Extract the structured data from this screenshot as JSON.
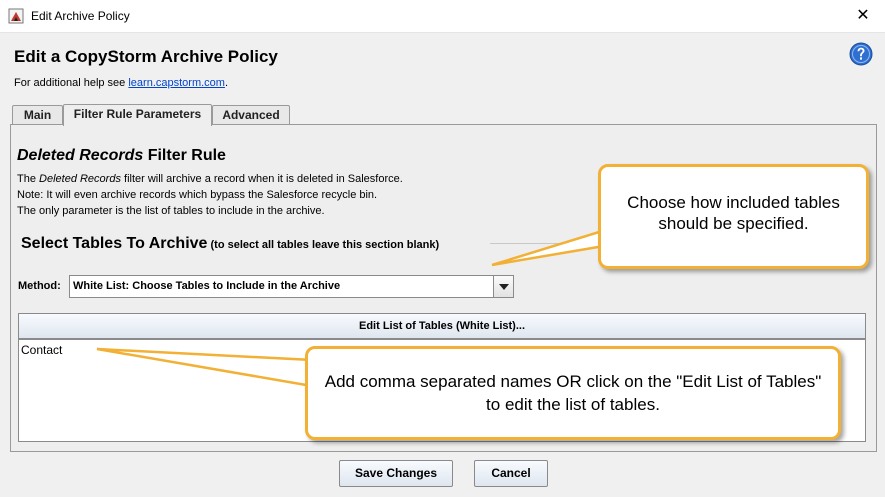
{
  "window": {
    "title": "Edit Archive Policy",
    "close_glyph": "✕"
  },
  "header": {
    "title": "Edit a CopyStorm Archive Policy",
    "help_prefix": "For additional help see ",
    "help_link": "learn.capstorm.com",
    "help_suffix": ".",
    "help_icon": "help-question-icon"
  },
  "tabs": [
    {
      "label": "Main",
      "active": false
    },
    {
      "label": "Filter Rule Parameters",
      "active": true
    },
    {
      "label": "Advanced",
      "active": false
    }
  ],
  "rule": {
    "title_italic": "Deleted Records",
    "title_rest": " Filter Rule",
    "line1_prefix": "The ",
    "line1_italic": "Deleted Records",
    "line1_rest": " filter will archive a record when it is deleted in Salesforce.",
    "line2": "Note: It will even archive records which bypass the Salesforce recycle bin.",
    "line3": "The only parameter is the list of tables to include in the archive."
  },
  "section": {
    "title": "Select Tables To Archive",
    "note": " (to select all tables leave this section blank)"
  },
  "method": {
    "label": "Method:",
    "value": "White List: Choose Tables to Include in the Archive"
  },
  "edit_list_button": "Edit List of Tables (White List)...",
  "tables_text": "Contact",
  "buttons": {
    "save": "Save Changes",
    "cancel": "Cancel"
  },
  "callouts": {
    "top": "Choose how included tables should be specified.",
    "bottom": "Add comma separated names OR click on the \"Edit List of Tables\" to edit the list of tables."
  },
  "colors": {
    "callout_border": "#f2b035",
    "link": "#0044cc",
    "help_icon": "#2f6fd0"
  }
}
